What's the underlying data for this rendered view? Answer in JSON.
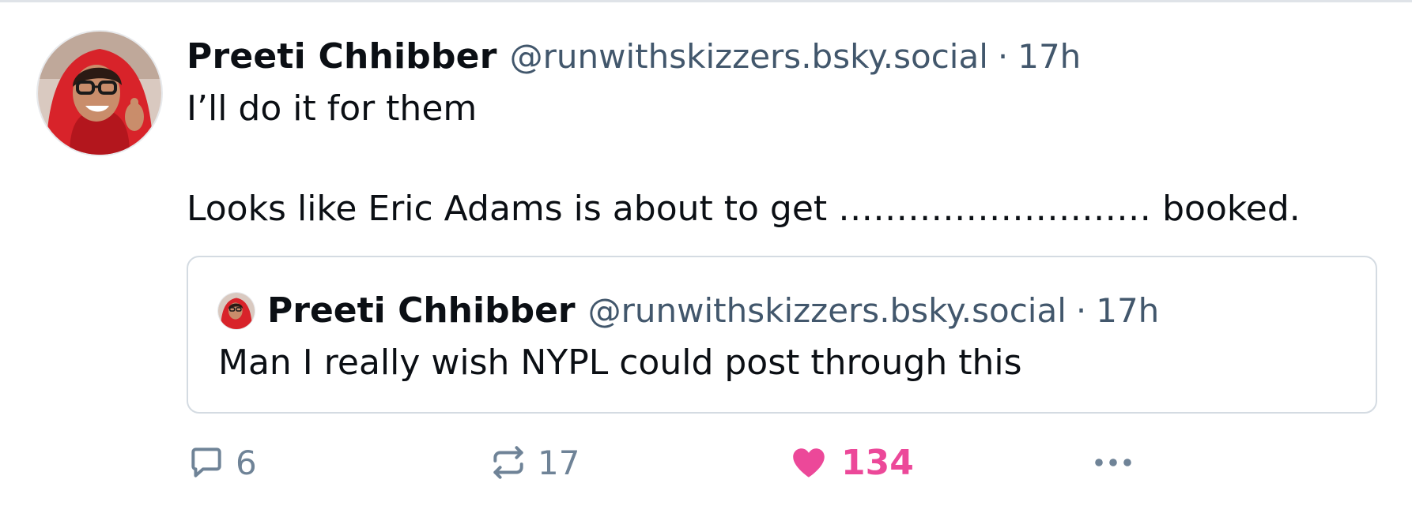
{
  "post": {
    "author_name": "Preeti Chhibber",
    "handle": "@runwithskizzers.bsky.social",
    "separator": "·",
    "time": "17h",
    "text_line_1": "I’ll do it for them",
    "text_line_2": "Looks like Eric Adams is about to get ……………………… booked."
  },
  "quote": {
    "author_name": "Preeti Chhibber",
    "handle": "@runwithskizzers.bsky.social",
    "separator": "·",
    "time": "17h",
    "text": "Man I really wish NYPL could post through this"
  },
  "actions": {
    "reply_count": "6",
    "repost_count": "17",
    "like_count": "134",
    "icons": {
      "reply": "reply-bubble-icon",
      "repost": "repost-arrows-icon",
      "like": "heart-filled-icon",
      "more": "ellipsis-icon"
    }
  },
  "colors": {
    "text_primary": "#0b0f14",
    "text_secondary": "#42576c",
    "action_gray": "#6f8397",
    "like_pink": "#ec4899",
    "border": "#d4dbe2"
  }
}
